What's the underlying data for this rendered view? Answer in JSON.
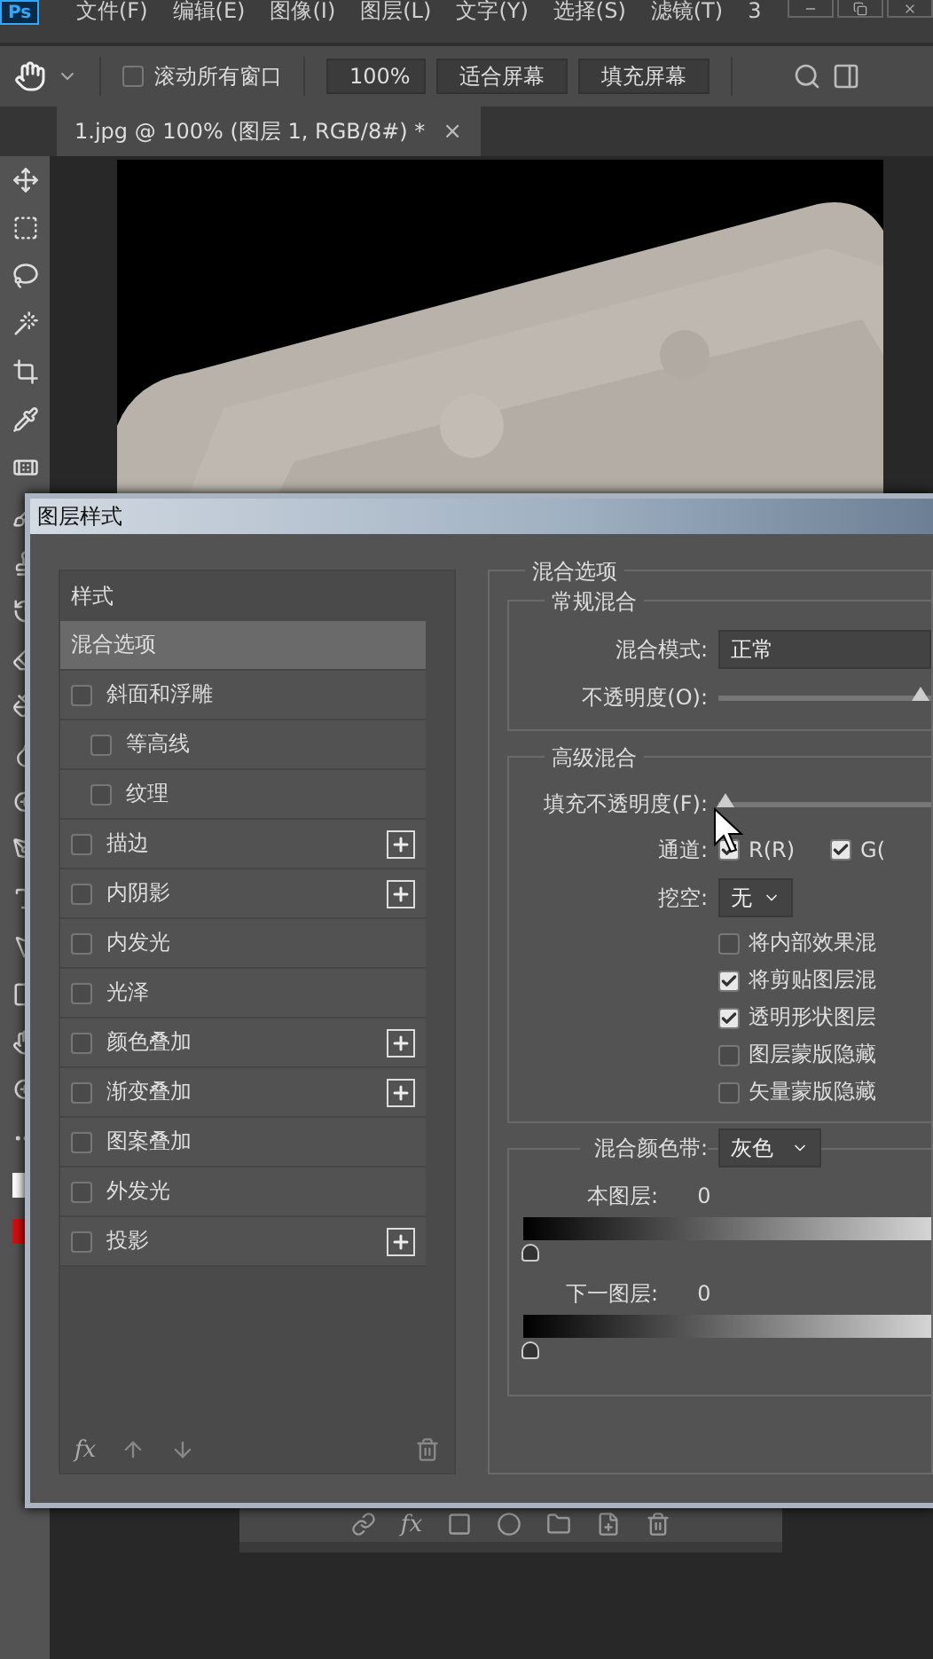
{
  "app": {
    "logo": "Ps"
  },
  "menu": [
    {
      "label": "文件(F)"
    },
    {
      "label": "编辑(E)"
    },
    {
      "label": "图像(I)"
    },
    {
      "label": "图层(L)"
    },
    {
      "label": "文字(Y)"
    },
    {
      "label": "选择(S)"
    },
    {
      "label": "滤镜(T)"
    },
    {
      "label": "3"
    }
  ],
  "options_bar": {
    "scroll_all": {
      "label": "滚动所有窗口",
      "checked": false
    },
    "zoom": "100%",
    "buttons": [
      "适合屏幕",
      "填充屏幕"
    ]
  },
  "document_tab": {
    "title": "1.jpg @ 100% (图层 1, RGB/8#) *",
    "close": "×"
  },
  "dialog": {
    "title": "图层样式",
    "styles_header": "样式",
    "styles": [
      {
        "label": "混合选项",
        "kind": "option",
        "selected": true
      },
      {
        "label": "斜面和浮雕",
        "kind": "effect",
        "checked": false,
        "selected": false,
        "add": false
      },
      {
        "label": "等高线",
        "kind": "sub",
        "checked": false,
        "selected": false,
        "add": false
      },
      {
        "label": "纹理",
        "kind": "sub",
        "checked": false,
        "selected": false,
        "add": false
      },
      {
        "label": "描边",
        "kind": "effect",
        "checked": false,
        "selected": false,
        "add": true
      },
      {
        "label": "内阴影",
        "kind": "effect",
        "checked": false,
        "selected": false,
        "add": true
      },
      {
        "label": "内发光",
        "kind": "effect",
        "checked": false,
        "selected": false,
        "add": false
      },
      {
        "label": "光泽",
        "kind": "effect",
        "checked": false,
        "selected": false,
        "add": false
      },
      {
        "label": "颜色叠加",
        "kind": "effect",
        "checked": false,
        "selected": false,
        "add": true
      },
      {
        "label": "渐变叠加",
        "kind": "effect",
        "checked": false,
        "selected": false,
        "add": true
      },
      {
        "label": "图案叠加",
        "kind": "effect",
        "checked": false,
        "selected": false,
        "add": false
      },
      {
        "label": "外发光",
        "kind": "effect",
        "checked": false,
        "selected": false,
        "add": false
      },
      {
        "label": "投影",
        "kind": "effect",
        "checked": false,
        "selected": false,
        "add": true
      }
    ],
    "fx": "fx",
    "blending": {
      "legend": "混合选项",
      "general": {
        "legend": "常规混合",
        "mode_label": "混合模式:",
        "mode": "正常",
        "opacity": {
          "label": "不透明度(O):",
          "level": 1
        }
      },
      "advanced": {
        "legend": "高级混合",
        "fill": {
          "label": "填充不透明度(F):",
          "level": 0
        },
        "channels_label": "通道:",
        "channels": [
          {
            "label": "R(R)",
            "checked": true
          },
          {
            "label": "G(",
            "checked": true
          }
        ],
        "knockout_label": "挖空:",
        "knockout": "无",
        "options": [
          {
            "label": "将内部效果混",
            "checked": false
          },
          {
            "label": "将剪贴图层混",
            "checked": true
          },
          {
            "label": "透明形状图层",
            "checked": true
          },
          {
            "label": "图层蒙版隐藏",
            "checked": false
          },
          {
            "label": "矢量蒙版隐藏",
            "checked": false
          }
        ]
      },
      "blend_if": {
        "label": "混合颜色带:",
        "value": "灰色",
        "bands": [
          {
            "label": "本图层:",
            "value": "0",
            "level": 0
          },
          {
            "label": "下一图层:",
            "value": "0",
            "level": 0
          }
        ]
      }
    }
  },
  "layers_footer": {
    "fx": "fx"
  }
}
